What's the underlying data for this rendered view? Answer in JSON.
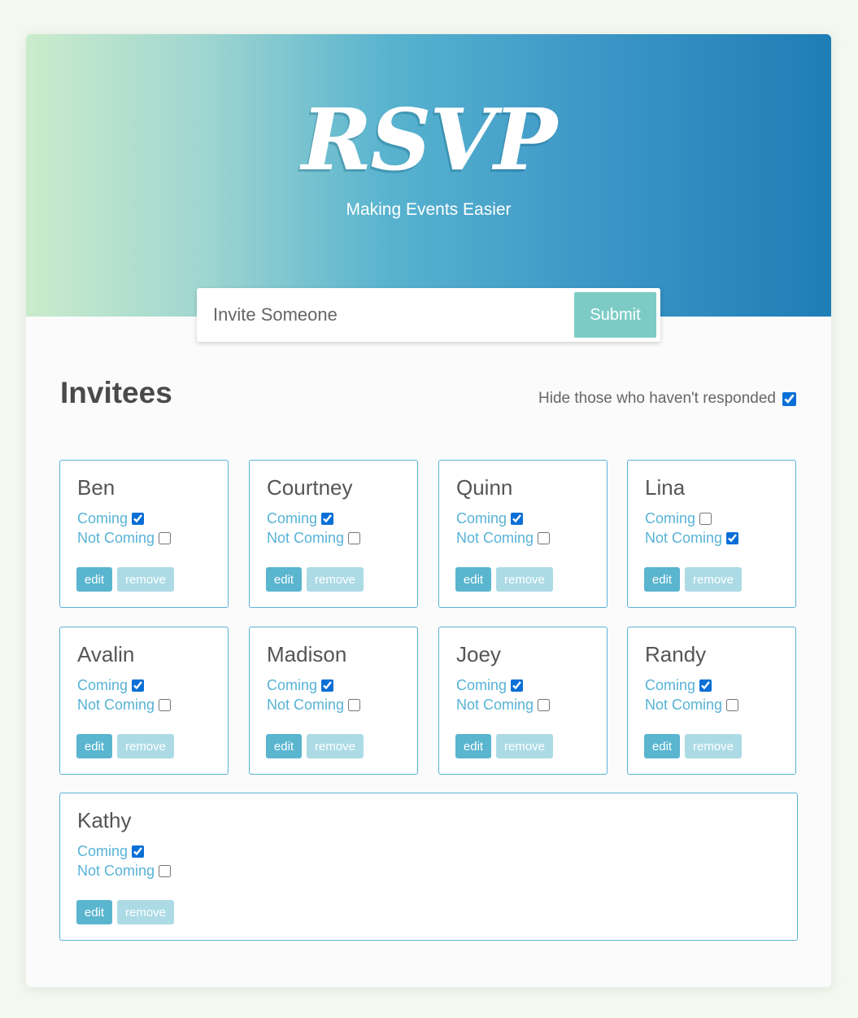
{
  "header": {
    "logo": "RSVP",
    "tagline": "Making Events Easier"
  },
  "invite_form": {
    "placeholder": "Invite Someone",
    "value": "",
    "submit_label": "Submit"
  },
  "main": {
    "title": "Invitees",
    "filter_label": "Hide those who haven't responded",
    "filter_checked": true
  },
  "labels": {
    "coming": "Coming",
    "not_coming": "Not Coming",
    "edit": "edit",
    "remove": "remove"
  },
  "invitees": [
    {
      "name": "Ben",
      "coming": true,
      "not_coming": false
    },
    {
      "name": "Courtney",
      "coming": true,
      "not_coming": false
    },
    {
      "name": "Quinn",
      "coming": true,
      "not_coming": false
    },
    {
      "name": "Lina",
      "coming": false,
      "not_coming": true
    },
    {
      "name": "Avalin",
      "coming": true,
      "not_coming": false
    },
    {
      "name": "Madison",
      "coming": true,
      "not_coming": false
    },
    {
      "name": "Joey",
      "coming": true,
      "not_coming": false
    },
    {
      "name": "Randy",
      "coming": true,
      "not_coming": false
    },
    {
      "name": "Kathy",
      "coming": true,
      "not_coming": false
    }
  ],
  "colors": {
    "accent": "#58b3d6",
    "submit": "#7cccc5",
    "edit_button": "#5ab5cf",
    "remove_button": "#acdbe6"
  }
}
